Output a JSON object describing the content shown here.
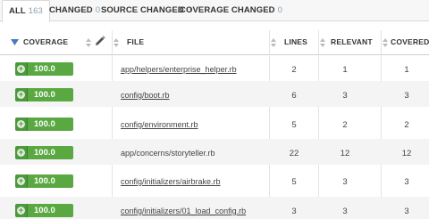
{
  "tabs": [
    {
      "label": "ALL",
      "count": "163",
      "active": true
    },
    {
      "label": "CHANGED",
      "count": "0",
      "active": false
    },
    {
      "label": "SOURCE CHANGED",
      "count": "0",
      "active": false
    },
    {
      "label": "COVERAGE CHANGED",
      "count": "0",
      "active": false
    }
  ],
  "table": {
    "headers": {
      "coverage": "COVERAGE",
      "file": "FILE",
      "lines": "LINES",
      "relevant": "RELEVANT",
      "covered": "COVERED"
    },
    "sort": {
      "column": "coverage",
      "direction": "descending"
    },
    "rows": [
      {
        "coverage": "100.0",
        "file": "app/helpers/enterprise_helper.rb",
        "lines": "2",
        "relevant": "1",
        "covered": "1"
      },
      {
        "coverage": "100.0",
        "file": "config/boot.rb",
        "lines": "6",
        "relevant": "3",
        "covered": "3"
      },
      {
        "coverage": "100.0",
        "file": "config/environment.rb",
        "lines": "5",
        "relevant": "2",
        "covered": "2"
      },
      {
        "coverage": "100.0",
        "file": "app/concerns/storyteller.rb",
        "lines": "22",
        "relevant": "12",
        "covered": "12"
      },
      {
        "coverage": "100.0",
        "file": "config/initializers/airbrake.rb",
        "lines": "5",
        "relevant": "3",
        "covered": "3"
      },
      {
        "coverage": "100.0",
        "file": "config/initializers/01_load_config.rb",
        "lines": "3",
        "relevant": "3",
        "covered": "3"
      }
    ]
  },
  "colors": {
    "coverage_badge": "#5aa842",
    "coverage_badge_dark": "#4b9a3c",
    "tab_count": "#8aa1b4",
    "sort_arrow": "#4a78c2"
  },
  "icons": {
    "sort": "sort-descending-icon",
    "edit": "pencil-icon",
    "expand": "plus-circle-icon"
  }
}
